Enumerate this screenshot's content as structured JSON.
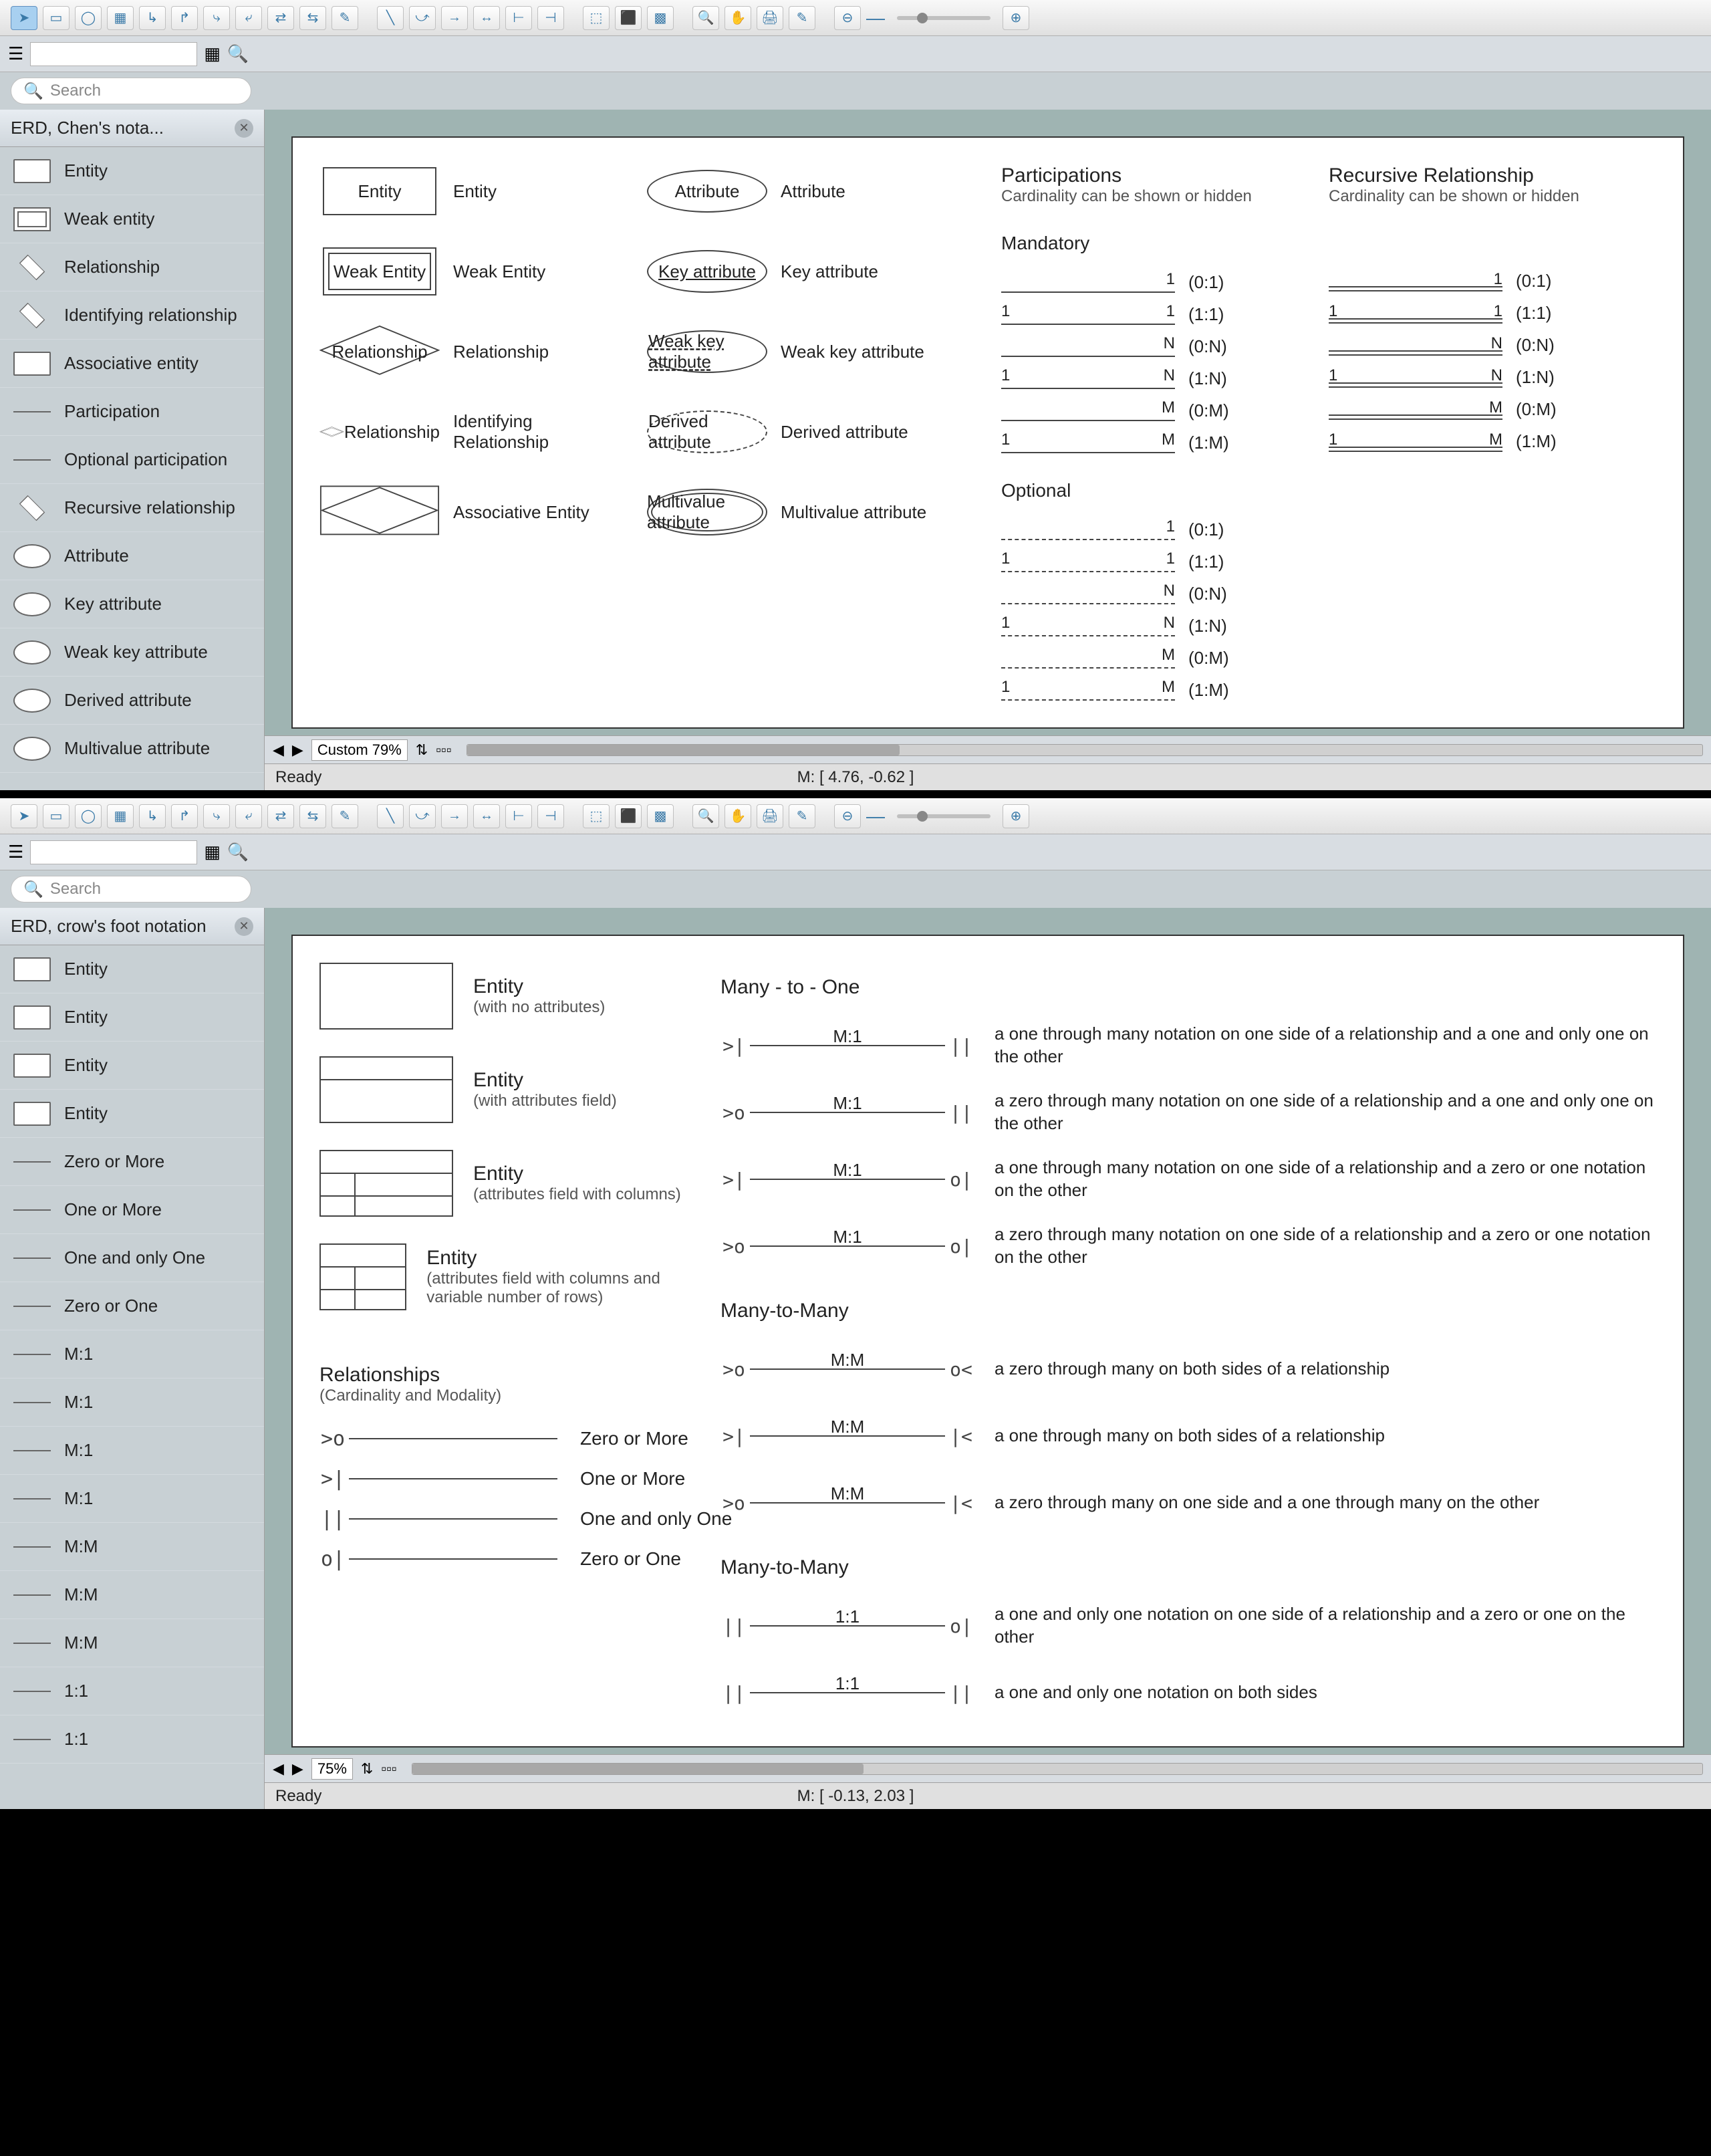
{
  "windows": [
    {
      "toolbar": {
        "active_tool": "pointer"
      },
      "search_placeholder": "Search",
      "panel_title": "ERD, Chen's nota...",
      "shapes": [
        "Entity",
        "Weak entity",
        "Relationship",
        "Identifying relationship",
        "Associative entity",
        "Participation",
        "Optional participation",
        "Recursive relationship",
        "Attribute",
        "Key attribute",
        "Weak key attribute",
        "Derived attribute",
        "Multivalue attribute"
      ],
      "zoom_label": "Custom 79%",
      "coord": "M: [ 4.76, -0.62 ]",
      "status": "Ready",
      "canvas": {
        "col1": [
          {
            "shape": "Entity",
            "label": "Entity"
          },
          {
            "shape": "Weak Entity",
            "label": "Weak Entity"
          },
          {
            "shape": "Relationship",
            "label": "Relationship"
          },
          {
            "shape": "Relationship",
            "label": "Identifying Relationship"
          },
          {
            "shape": "Associative Entity",
            "label": "Associative Entity"
          }
        ],
        "col2": [
          {
            "shape": "Attribute",
            "label": "Attribute"
          },
          {
            "shape": "Key attribute",
            "label": "Key attribute"
          },
          {
            "shape": "Weak key attribute",
            "label": "Weak key attribute"
          },
          {
            "shape": "Derived attribute",
            "label": "Derived attribute"
          },
          {
            "shape": "Multivalue attribute",
            "label": "Multivalue attribute"
          }
        ],
        "participations": {
          "heading": "Participations",
          "subhead": "Cardinality can be shown or hidden",
          "mandatory_label": "Mandatory",
          "mandatory": [
            {
              "l": "",
              "r": "1",
              "card": "(0:1)"
            },
            {
              "l": "1",
              "r": "1",
              "card": "(1:1)"
            },
            {
              "l": "",
              "r": "N",
              "card": "(0:N)"
            },
            {
              "l": "1",
              "r": "N",
              "card": "(1:N)"
            },
            {
              "l": "",
              "r": "M",
              "card": "(0:M)"
            },
            {
              "l": "1",
              "r": "M",
              "card": "(1:M)"
            }
          ],
          "optional_label": "Optional",
          "optional": [
            {
              "l": "",
              "r": "1",
              "card": "(0:1)"
            },
            {
              "l": "1",
              "r": "1",
              "card": "(1:1)"
            },
            {
              "l": "",
              "r": "N",
              "card": "(0:N)"
            },
            {
              "l": "1",
              "r": "N",
              "card": "(1:N)"
            },
            {
              "l": "",
              "r": "M",
              "card": "(0:M)"
            },
            {
              "l": "1",
              "r": "M",
              "card": "(1:M)"
            }
          ]
        },
        "recursive": {
          "heading": "Recursive Relationship",
          "subhead": "Cardinality can be shown or hidden",
          "rows": [
            {
              "l": "",
              "r": "1",
              "card": "(0:1)"
            },
            {
              "l": "1",
              "r": "1",
              "card": "(1:1)"
            },
            {
              "l": "",
              "r": "N",
              "card": "(0:N)"
            },
            {
              "l": "1",
              "r": "N",
              "card": "(1:N)"
            },
            {
              "l": "",
              "r": "M",
              "card": "(0:M)"
            },
            {
              "l": "1",
              "r": "M",
              "card": "(1:M)"
            }
          ]
        }
      }
    },
    {
      "toolbar": {
        "active_tool": "pointer"
      },
      "search_placeholder": "Search",
      "panel_title": "ERD, crow's foot notation",
      "shapes": [
        "Entity",
        "Entity",
        "Entity",
        "Entity",
        "Zero or More",
        "One or More",
        "One and only One",
        "Zero or One",
        "M:1",
        "M:1",
        "M:1",
        "M:1",
        "M:M",
        "M:M",
        "M:M",
        "1:1",
        "1:1"
      ],
      "zoom_label": "75%",
      "coord": "M: [ -0.13, 2.03 ]",
      "status": "Ready",
      "canvas": {
        "entities": [
          {
            "title": "Entity",
            "sub": "(with no attributes)",
            "v": "plain"
          },
          {
            "title": "Entity",
            "sub": "(with attributes field)",
            "v": "hdr"
          },
          {
            "title": "Entity",
            "sub": "(attributes field with columns)",
            "v": "cols"
          },
          {
            "title": "Entity",
            "sub": "(attributes field with columns and variable number of rows)",
            "v": "cols"
          }
        ],
        "rel_heading": "Relationships",
        "rel_sub": "(Cardinality and Modality)",
        "cardinalities": [
          {
            "sym_l": ">o",
            "sym_r": "",
            "label": "Zero or More"
          },
          {
            "sym_l": ">|",
            "sym_r": "",
            "label": "One or More"
          },
          {
            "sym_l": "||",
            "sym_r": "",
            "label": "One and only One"
          },
          {
            "sym_l": "o|",
            "sym_r": "",
            "label": "Zero or One"
          }
        ],
        "sections": [
          {
            "title": "Many - to - One",
            "rows": [
              {
                "l": ">|",
                "mid": "M:1",
                "r": "||",
                "desc": "a one through many notation on one side of a relationship and a one and only one on the other"
              },
              {
                "l": ">o",
                "mid": "M:1",
                "r": "||",
                "desc": "a zero through many notation on one side of a relationship and a one and only one on the other"
              },
              {
                "l": ">|",
                "mid": "M:1",
                "r": "o|",
                "desc": "a one through many notation on one side of a relationship and a zero or one notation on the other"
              },
              {
                "l": ">o",
                "mid": "M:1",
                "r": "o|",
                "desc": "a zero through many notation on one side of a relationship and a zero or one notation on the other"
              }
            ]
          },
          {
            "title": "Many-to-Many",
            "rows": [
              {
                "l": ">o",
                "mid": "M:M",
                "r": "o<",
                "desc": "a zero through many on both sides of a relationship"
              },
              {
                "l": ">|",
                "mid": "M:M",
                "r": "|<",
                "desc": "a one through many on both sides of a relationship"
              },
              {
                "l": ">o",
                "mid": "M:M",
                "r": "|<",
                "desc": "a zero through many on one side and a one through many on the other"
              }
            ]
          },
          {
            "title": "Many-to-Many",
            "rows": [
              {
                "l": "||",
                "mid": "1:1",
                "r": "o|",
                "desc": "a one and only one notation on one side of a relationship and a zero or one on the other"
              },
              {
                "l": "||",
                "mid": "1:1",
                "r": "||",
                "desc": "a one and only one notation on both sides"
              }
            ]
          }
        ]
      }
    }
  ]
}
